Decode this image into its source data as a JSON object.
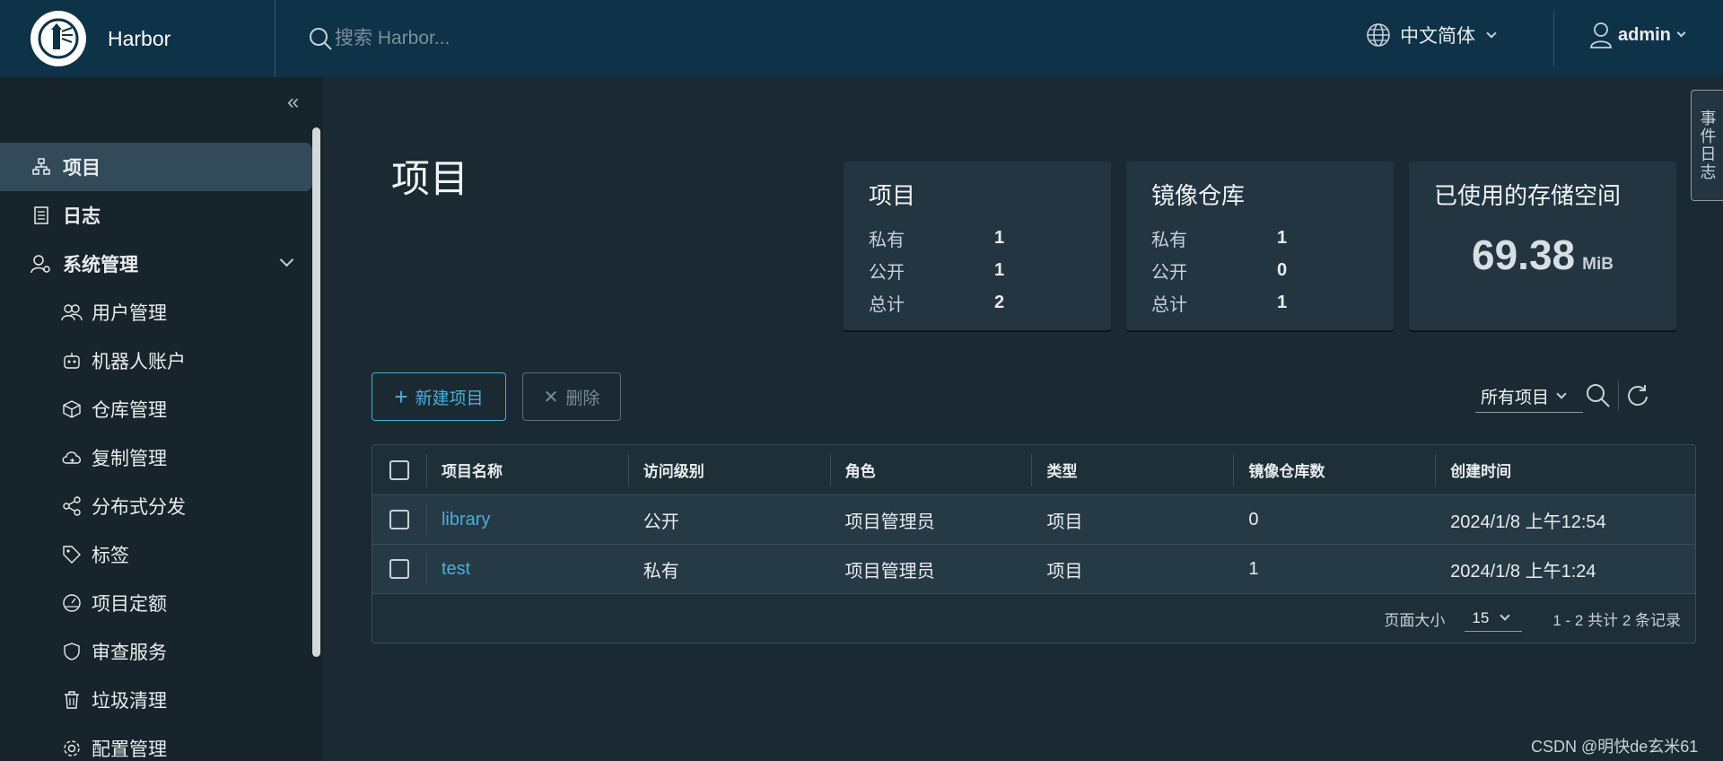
{
  "header": {
    "brand_name": "Harbor",
    "search_placeholder": "搜索 Harbor...",
    "language": "中文简体",
    "user": "admin"
  },
  "sidebar": {
    "items": [
      {
        "label": "项目",
        "icon": "projects-icon",
        "active": true
      },
      {
        "label": "日志",
        "icon": "logs-icon"
      },
      {
        "label": "系统管理",
        "icon": "admin-icon",
        "expanded": true
      }
    ],
    "sub_items": [
      {
        "label": "用户管理",
        "icon": "users-icon"
      },
      {
        "label": "机器人账户",
        "icon": "robot-icon"
      },
      {
        "label": "仓库管理",
        "icon": "registry-icon"
      },
      {
        "label": "复制管理",
        "icon": "replication-icon"
      },
      {
        "label": "分布式分发",
        "icon": "distribution-icon"
      },
      {
        "label": "标签",
        "icon": "tag-icon"
      },
      {
        "label": "项目定额",
        "icon": "quota-icon"
      },
      {
        "label": "审查服务",
        "icon": "shield-icon"
      },
      {
        "label": "垃圾清理",
        "icon": "trash-icon"
      },
      {
        "label": "配置管理",
        "icon": "gear-icon"
      }
    ]
  },
  "main": {
    "title": "项目",
    "cards": {
      "projects": {
        "title": "项目",
        "rows": [
          {
            "k": "私有",
            "v": "1"
          },
          {
            "k": "公开",
            "v": "1"
          },
          {
            "k": "总计",
            "v": "2"
          }
        ]
      },
      "repos": {
        "title": "镜像仓库",
        "rows": [
          {
            "k": "私有",
            "v": "1"
          },
          {
            "k": "公开",
            "v": "0"
          },
          {
            "k": "总计",
            "v": "1"
          }
        ]
      },
      "storage": {
        "title": "已使用的存储空间",
        "value": "69.38",
        "unit": "MiB"
      }
    },
    "buttons": {
      "new_project": "新建项目",
      "delete": "删除"
    },
    "filter": "所有项目",
    "table": {
      "columns": [
        "项目名称",
        "访问级别",
        "角色",
        "类型",
        "镜像仓库数",
        "创建时间"
      ],
      "rows": [
        [
          "library",
          "公开",
          "项目管理员",
          "项目",
          "0",
          "2024/1/8 上午12:54"
        ],
        [
          "test",
          "私有",
          "项目管理员",
          "项目",
          "1",
          "2024/1/8 上午1:24"
        ]
      ],
      "footer": {
        "page_size_label": "页面大小",
        "page_size": "15",
        "summary": "1 - 2 共计 2 条记录"
      }
    }
  },
  "event_log": "事件日志",
  "watermark": "CSDN @明快de玄米61",
  "colors": {
    "header_bg": "#0e3247",
    "sidebar_bg": "#17242b",
    "main_bg": "#1b2a32",
    "accent": "#49afd9",
    "active_nav": "#324a59"
  }
}
